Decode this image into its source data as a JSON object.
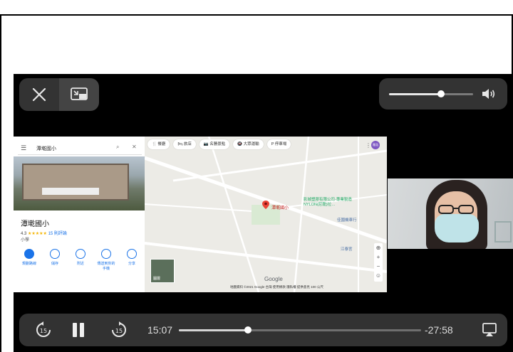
{
  "player": {
    "volume_level": 0.62,
    "progress_fraction": 0.286,
    "time_elapsed": "15:07",
    "time_remaining": "-27:58",
    "skip_back_seconds": "15",
    "skip_forward_seconds": "15"
  },
  "map": {
    "search_query": "潭墘國小",
    "place_name": "潭墘國小",
    "rating": "4.3",
    "stars": "★★★★★",
    "review_count": "15 則評論",
    "place_type": "小學",
    "actions": [
      "規劃路線",
      "儲存",
      "附近",
      "傳送到你的手機",
      "分享"
    ],
    "chips": [
      "🍴 餐廳",
      "🛏 旅店",
      "📷 名勝景點",
      "🚇 大眾運輸",
      "P 停車場"
    ],
    "pin_label": "潭墘國小",
    "company_label": "影城塑膠有限公司-專業製造NYLON(尼龍)拉…",
    "station_label": "佳園機車行",
    "temple_label": "江泰宮",
    "google_logo": "Google",
    "attribution": "地圖資料 ©2021 Google   台灣   使用條款   隱私權   提供意見   100 公尺",
    "layer_label": "圖層",
    "avatar": "雅浩"
  },
  "colors": {
    "accent": "#1a73e8",
    "pin": "#ea4335"
  }
}
